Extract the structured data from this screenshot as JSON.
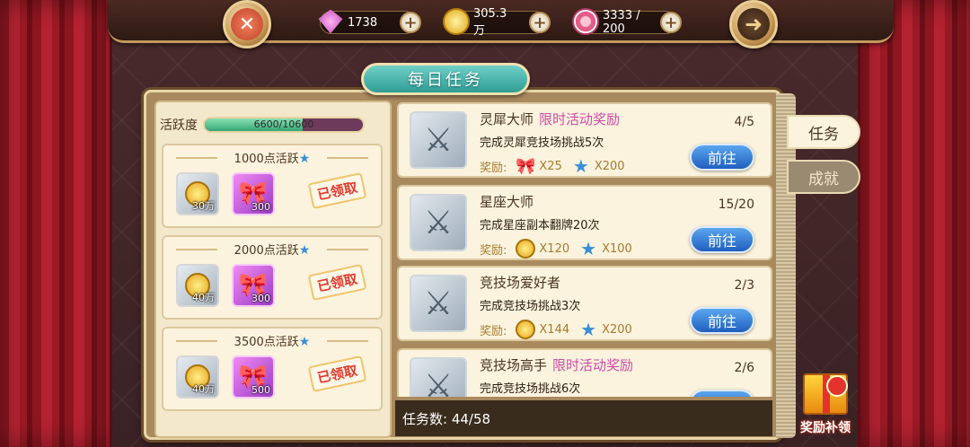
{
  "header": {
    "gems": "1738",
    "gold": "305.3万",
    "stamina": "3333 / 200",
    "close_symbol": "✕",
    "back_symbol": "➜"
  },
  "title": "每日任务",
  "activity": {
    "label": "活跃度",
    "value": "6600/10600",
    "progress_fraction": 0.62
  },
  "tiers": [
    {
      "title": "1000点活跃",
      "gold_qty": "30万",
      "bow_qty": "300",
      "status": "已领取"
    },
    {
      "title": "2000点活跃",
      "gold_qty": "40万",
      "bow_qty": "300",
      "status": "已领取"
    },
    {
      "title": "3500点活跃",
      "gold_qty": "40万",
      "bow_qty": "500",
      "status": "已领取"
    }
  ],
  "reward_label": "奖励:",
  "go_label": "前往",
  "tasks": [
    {
      "name": "灵犀大师",
      "tag": "限时活动奖励",
      "progress": "4/5",
      "desc": "完成灵犀竞技场挑战5次",
      "rewards": [
        {
          "icon": "bow-icon",
          "qty": "X25"
        },
        {
          "icon": "star-icon",
          "qty": "X200"
        }
      ]
    },
    {
      "name": "星座大师",
      "tag": "",
      "progress": "15/20",
      "desc": "完成星座副本翻牌20次",
      "rewards": [
        {
          "icon": "coin-icon",
          "qty": "X120"
        },
        {
          "icon": "star-icon",
          "qty": "X100"
        }
      ]
    },
    {
      "name": "竞技场爱好者",
      "tag": "",
      "progress": "2/3",
      "desc": "完成竞技场挑战3次",
      "rewards": [
        {
          "icon": "coin-icon",
          "qty": "X144"
        },
        {
          "icon": "star-icon",
          "qty": "X200"
        }
      ]
    },
    {
      "name": "竞技场高手",
      "tag": "限时活动奖励",
      "progress": "2/6",
      "desc": "完成竞技场挑战6次",
      "rewards": []
    }
  ],
  "task_count": "任务数:  44/58",
  "side_tabs": {
    "task": "任务",
    "achievement": "成就"
  },
  "bonus_label": "奖励补领"
}
